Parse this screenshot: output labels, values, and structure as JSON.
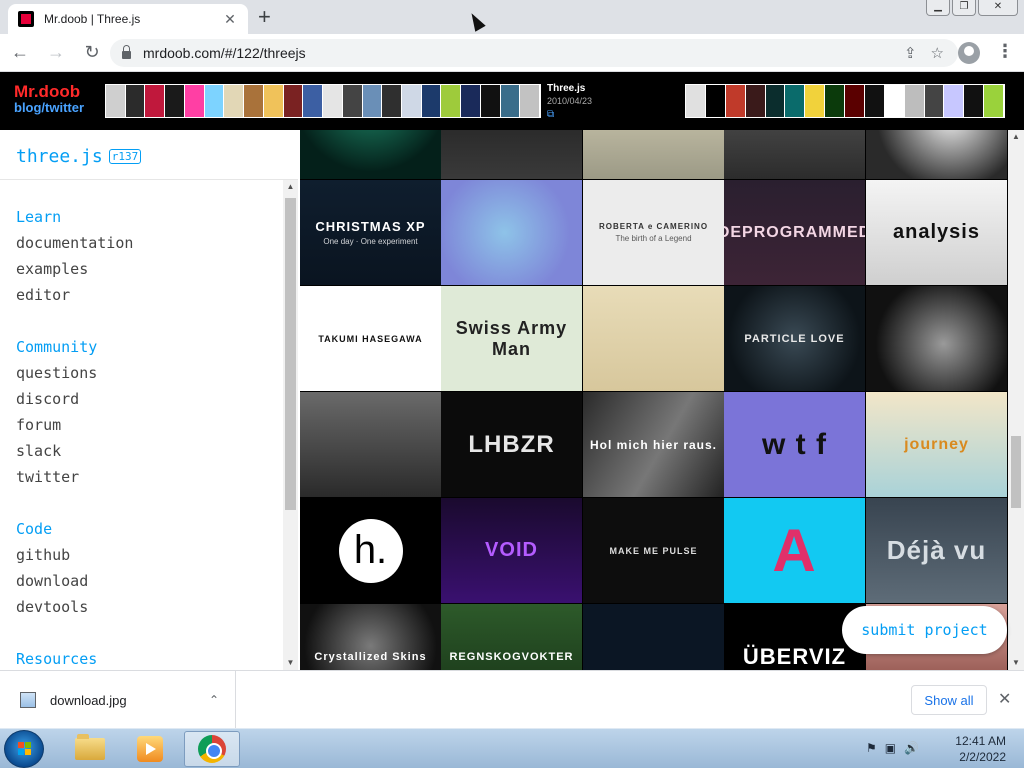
{
  "browser": {
    "tab_title": "Mr.doob | Three.js",
    "tab_close": "✕",
    "new_tab": "+",
    "window_buttons": [
      "▁",
      "❐",
      "✕"
    ],
    "back": "←",
    "forward": "→",
    "reload": "↻",
    "url": "mrdoob.com/#/122/threejs",
    "share_icon": "⇪",
    "bookmark_icon": "☆",
    "menu": "⋮"
  },
  "mrdoob": {
    "logo_line1": "Mr.doob",
    "logo_line2": "blog/twitter",
    "project_name": "Three.js",
    "project_date": "2010/04/23",
    "project_link_icon": "⧉",
    "thumb_colors_left": [
      "#cfcfcf",
      "#2b2b2b",
      "#c0183c",
      "#1a1a1a",
      "#ff3fa4",
      "#7dd3ff",
      "#e2d7b6",
      "#a9723a",
      "#f0c25a",
      "#7a2222",
      "#3c5fa3",
      "#e5e5e5",
      "#444",
      "#6a8fb7",
      "#2f2f2f",
      "#cfd8e6",
      "#1c3a6b",
      "#9ecb3b",
      "#1a2a5a",
      "#111",
      "#3a6d8a",
      "#c2c2c2"
    ],
    "thumb_colors_right": [
      "#e0e0e0",
      "#000",
      "#c03a2a",
      "#3a1a1a",
      "#0b2d2d",
      "#0a6b6b",
      "#f1d23b",
      "#0b3a0b",
      "#5a0000",
      "#111",
      "#fff",
      "#bdbdbd",
      "#444",
      "#c7c7ff",
      "#111",
      "#9ad23b"
    ]
  },
  "sidebar": {
    "title": "three.js",
    "revision": "r137",
    "sections": [
      {
        "heading": "Learn",
        "links": [
          "documentation",
          "examples",
          "editor"
        ]
      },
      {
        "heading": "Community",
        "links": [
          "questions",
          "discord",
          "forum",
          "slack",
          "twitter"
        ]
      },
      {
        "heading": "Code",
        "links": [
          "github",
          "download",
          "devtools"
        ]
      },
      {
        "heading": "Resources",
        "links": []
      }
    ]
  },
  "grid": {
    "tiles": [
      {
        "label": "",
        "bg": "radial-gradient(circle at 50% 20%, #1f8a6a, #04201a 70%)",
        "color": "#fff",
        "size": 12
      },
      {
        "label": "",
        "bg": "linear-gradient(#1a1a1a, #3a3a3a)",
        "color": "#fff",
        "size": 12
      },
      {
        "label": "",
        "bg": "linear-gradient(#d8d2b8, #9c9a86)",
        "color": "#333",
        "size": 12
      },
      {
        "label": "",
        "bg": "linear-gradient(#5a5a5a, #2c2c2c)",
        "color": "#fff",
        "size": 12
      },
      {
        "label": "",
        "bg": "radial-gradient(circle at 60% 40%, #f2f2f2, #2a2a2a 70%)",
        "color": "#fff",
        "size": 12
      },
      {
        "label": "CHRISTMAS XP",
        "sub": "One day · One experiment",
        "bg": "linear-gradient(#0f1e2e, #0a1420)",
        "color": "#fff",
        "size": 13
      },
      {
        "label": "",
        "bg": "radial-gradient(circle at 45% 50%, #8ec3e8, #7e86d8 70%)",
        "color": "#fff",
        "size": 12
      },
      {
        "label": "ROBERTA e CAMERINO",
        "sub": "The birth of a Legend",
        "bg": "#ececec",
        "color": "#333",
        "size": 8
      },
      {
        "label": "DEPROGRAMMED",
        "bg": "linear-gradient(#2a1f2f, #3d2436)",
        "color": "#f3d6e4",
        "size": 16
      },
      {
        "label": "analysis",
        "bg": "linear-gradient(#f4f4f4, #cfcfcf)",
        "color": "#111",
        "size": 20
      },
      {
        "label": "TAKUMI HASEGAWA",
        "bg": "#ffffff",
        "color": "#111",
        "size": 9
      },
      {
        "label": "Swiss Army Man",
        "bg": "#dfead7",
        "color": "#222",
        "size": 18
      },
      {
        "label": "",
        "bg": "linear-gradient(#e8dcb8, #d7c79c)",
        "color": "#333",
        "size": 12
      },
      {
        "label": "PARTICLE LOVE",
        "bg": "radial-gradient(circle, #3a4a55, #0d1419 75%)",
        "color": "#e8e8e8",
        "size": 11
      },
      {
        "label": "",
        "bg": "radial-gradient(circle at 55% 55%, #9a9a9a, #111 70%)",
        "color": "#fff",
        "size": 12
      },
      {
        "label": "",
        "bg": "linear-gradient(#6a6a6a, #2a2a2a)",
        "color": "#fff",
        "size": 12
      },
      {
        "label": "LHBZR",
        "bg": "#0b0b0b",
        "color": "#e6e6e6",
        "size": 24
      },
      {
        "label": "Hol mich hier raus.",
        "bg": "linear-gradient(120deg, #2a2a2a, #777 55%, #222)",
        "color": "#fff",
        "size": 12
      },
      {
        "label": "w t f",
        "bg": "#7b74d8",
        "color": "#111",
        "size": 30
      },
      {
        "label": "journey",
        "bg": "linear-gradient(#f2e6c8, #a9d2d8)",
        "color": "#d98a1f",
        "size": 16
      },
      {
        "label": "h.",
        "bg": "#000000",
        "color": "#000",
        "size": 36
      },
      {
        "label": "VOID",
        "bg": "linear-gradient(#1a0a2e, #3a1070)",
        "color": "#b45cff",
        "size": 20
      },
      {
        "label": "MAKE ME PULSE",
        "bg": "#0d0d0d",
        "color": "#ddd",
        "size": 9
      },
      {
        "label": "A",
        "bg": "#12c9f2",
        "color": "#e0306a",
        "size": 60
      },
      {
        "label": "Déjà vu",
        "bg": "linear-gradient(#384450, #5e6c78)",
        "color": "#d7dde2",
        "size": 26
      },
      {
        "label": "Crystallized Skins",
        "bg": "radial-gradient(circle at 50% 40%, #7a7a7a, #111 70%)",
        "color": "#fff",
        "size": 11
      },
      {
        "label": "REGNSKOGVOKTER",
        "bg": "linear-gradient(#2d5a2a, #173317)",
        "color": "#fff",
        "size": 11
      },
      {
        "label": "",
        "bg": "#0b1624",
        "color": "#4bd0e0",
        "size": 12
      },
      {
        "label": "ÜBERVIZ",
        "bg": "#000000",
        "color": "#fff",
        "size": 22
      },
      {
        "label": "",
        "bg": "linear-gradient(#d9a29a, #7a3a34)",
        "color": "#fff",
        "size": 12
      }
    ],
    "submit_label": "submit project"
  },
  "downloads": {
    "file_name": "download.jpg",
    "chevron": "⌃",
    "show_all": "Show all",
    "close": "✕"
  },
  "taskbar": {
    "time": "12:41 AM",
    "date": "2/2/2022",
    "tray_icons": [
      "⚑",
      "▣",
      "🔊"
    ]
  }
}
